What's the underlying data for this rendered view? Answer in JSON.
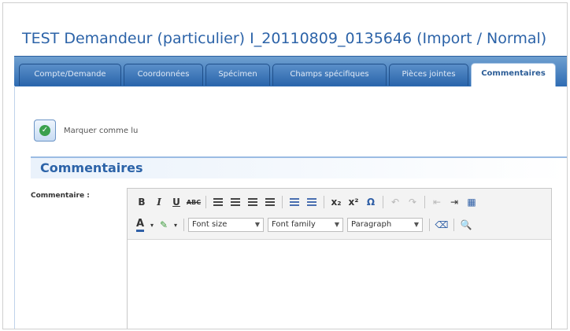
{
  "title": "TEST Demandeur (particulier)   I_20110809_0135646 (Import / Normal)",
  "tabs": [
    {
      "label": "Compte/Demande"
    },
    {
      "label": "Coordonnées"
    },
    {
      "label": "Spécimen"
    },
    {
      "label": "Champs spécifiques"
    },
    {
      "label": "Pièces jointes"
    },
    {
      "label": "Commentaires"
    }
  ],
  "active_tab": "Commentaires",
  "mark_read": {
    "label": "Marquer comme lu"
  },
  "section": {
    "title": "Commentaires"
  },
  "comment_field": {
    "label": "Commentaire :",
    "value": ""
  },
  "toolbar": {
    "bold": "B",
    "italic": "I",
    "underline": "U",
    "strike": "ABC",
    "subscript": "x₂",
    "superscript": "x²",
    "special_char": "Ω",
    "font_color": "A",
    "font_size": "Font size",
    "font_family": "Font family",
    "format": "Paragraph"
  },
  "colors": {
    "accent": "#2c63a8",
    "tab_bg": "#2f6cb3",
    "check": "#3aa04d"
  }
}
